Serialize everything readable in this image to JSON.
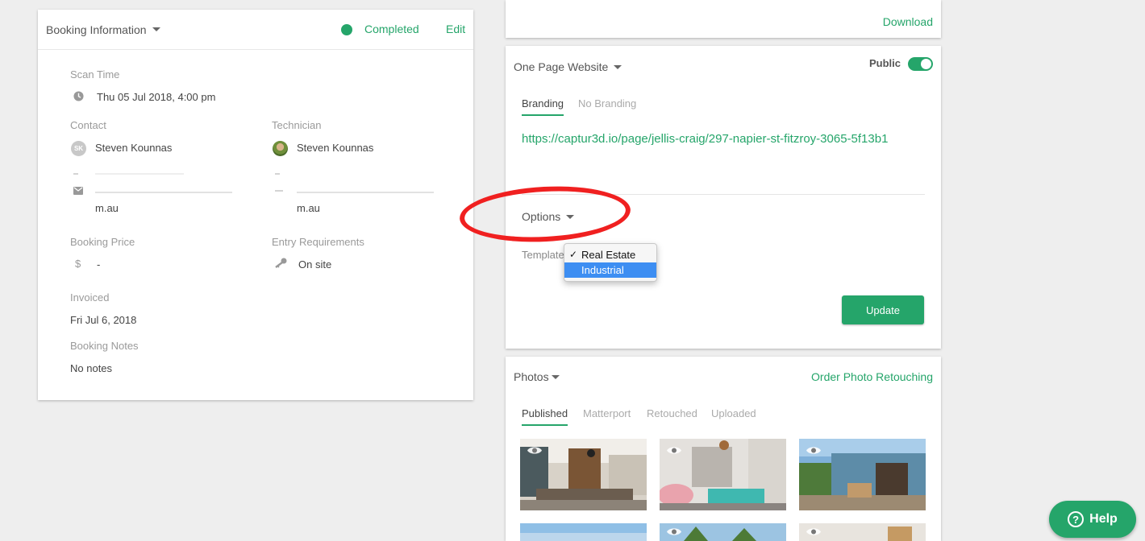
{
  "booking": {
    "title": "Booking Information",
    "status": "Completed",
    "edit_label": "Edit",
    "scan_time_label": "Scan Time",
    "scan_time": "Thu 05 Jul 2018, 4:00 pm",
    "contact_label": "Contact",
    "contact_initials": "SK",
    "contact_name": "Steven Kounnas",
    "contact_email_tail": "m.au",
    "technician_label": "Technician",
    "technician_name": "Steven Kounnas",
    "technician_email_tail": "m.au",
    "price_label": "Booking Price",
    "price_icon": "$",
    "price": "-",
    "entry_label": "Entry Requirements",
    "entry": "On site",
    "invoiced_label": "Invoiced",
    "invoiced": "Fri Jul 6, 2018",
    "notes_label": "Booking Notes",
    "notes": "No notes"
  },
  "download": {
    "label": "Download"
  },
  "website": {
    "title": "One Page Website",
    "public_label": "Public",
    "public_on": true,
    "tabs": [
      {
        "label": "Branding",
        "active": true
      },
      {
        "label": "No Branding",
        "active": false
      }
    ],
    "url": "https://captur3d.io/page/jellis-craig/297-napier-st-fitzroy-3065-5f13b1",
    "options_label": "Options",
    "template_label": "Template",
    "template_options": [
      {
        "label": "Real Estate",
        "selected": true,
        "check": "✓"
      },
      {
        "label": "Industrial",
        "selected": false
      }
    ],
    "update_label": "Update"
  },
  "photos": {
    "title": "Photos",
    "order_label": "Order Photo Retouching",
    "tabs": [
      {
        "label": "Published",
        "active": true
      },
      {
        "label": "Matterport",
        "active": false
      },
      {
        "label": "Retouched",
        "active": false
      },
      {
        "label": "Uploaded",
        "active": false
      }
    ]
  },
  "help": {
    "label": "Help",
    "icon": "?"
  },
  "colors": {
    "accent": "#25a56a",
    "annotation": "#f02020",
    "highlight": "#3d8ef2"
  }
}
